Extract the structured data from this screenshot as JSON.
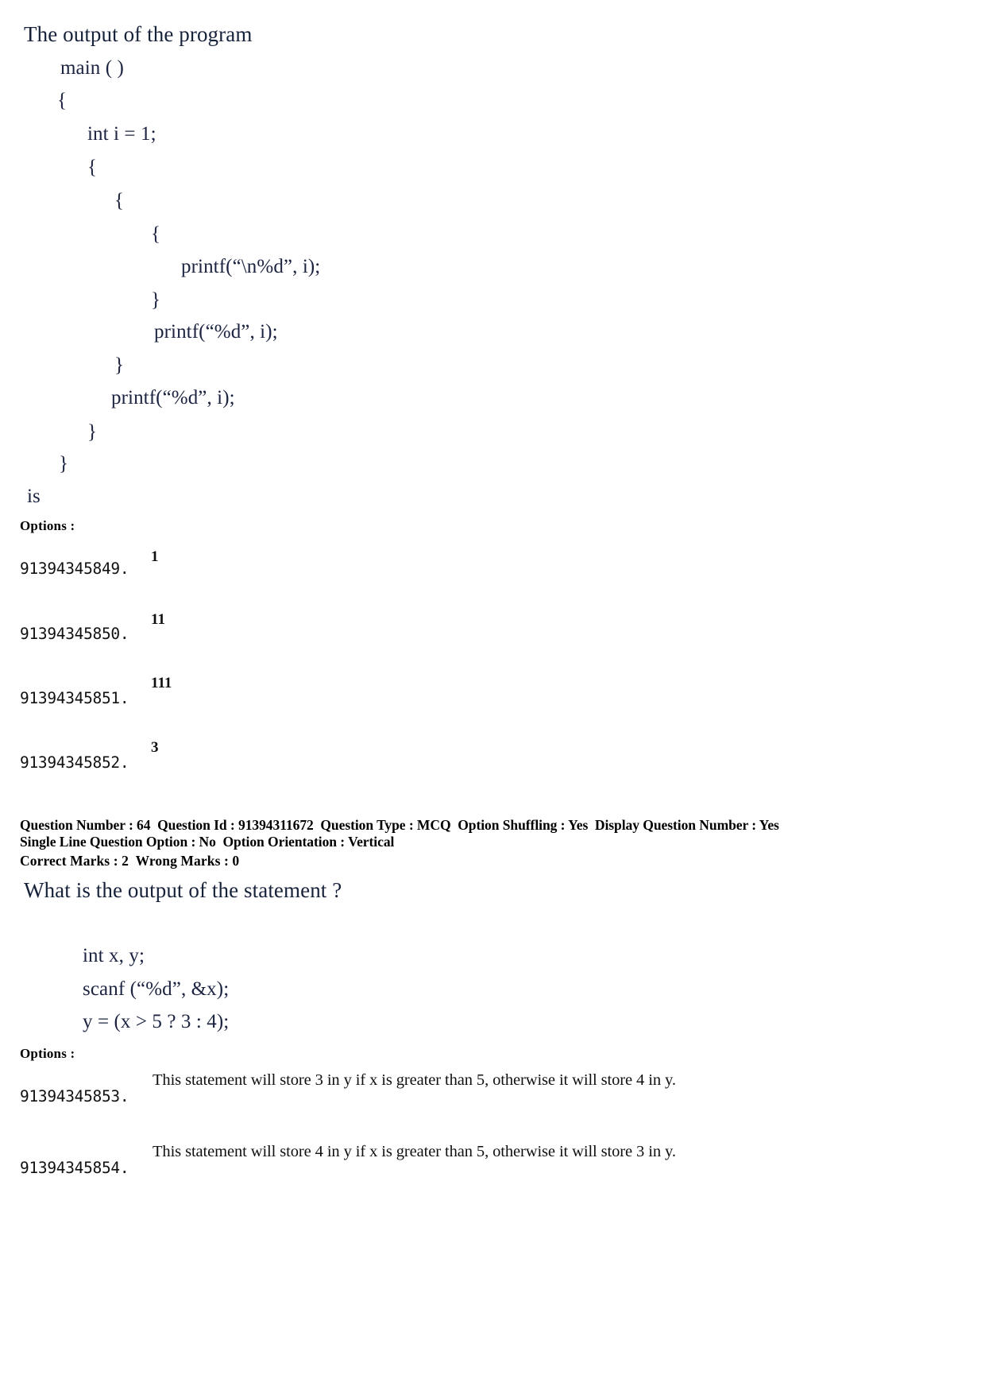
{
  "question_1": {
    "stem": "The output of the program",
    "code_lines": [
      {
        "text": "main ( )",
        "indent": 1
      },
      {
        "text": "{",
        "indent": 1
      },
      {
        "text": "int i = 1;",
        "indent": 2
      },
      {
        "text": "{",
        "indent": 2
      },
      {
        "text": "{",
        "indent": 3
      },
      {
        "text": "{",
        "indent": 4
      },
      {
        "text": "printf(“\\n%d”, i);",
        "indent": 5
      },
      {
        "text": "}",
        "indent": 4
      },
      {
        "text": "printf(“%d”, i);",
        "indent": 4
      },
      {
        "text": "}",
        "indent": 3
      },
      {
        "text": "printf(“%d”, i);",
        "indent": 3
      },
      {
        "text": "}",
        "indent": 2
      },
      {
        "text": "}",
        "indent": 1
      }
    ],
    "tail": "is",
    "options_label": "Options :",
    "options": [
      {
        "id": "91394345849.",
        "value": "1"
      },
      {
        "id": "91394345850.",
        "value": "11"
      },
      {
        "id": "91394345851.",
        "value": "111"
      },
      {
        "id": "91394345852.",
        "value": "3"
      }
    ]
  },
  "question_2": {
    "meta_line_1": "Question Number : 64  Question Id : 91394311672  Question Type : MCQ  Option Shuffling : Yes  Display Question Number : Yes",
    "meta_line_2": "Single Line Question Option : No  Option Orientation : Vertical",
    "marks_line": "Correct Marks : 2  Wrong Marks : 0",
    "stem": "What is the output of the statement ?",
    "code_lines": [
      {
        "text": "int x, y;"
      },
      {
        "text": "scanf (“%d”, &x);"
      },
      {
        "text": "y = (x > 5 ? 3 : 4);"
      }
    ],
    "options_label": "Options :",
    "options": [
      {
        "id": "91394345853.",
        "value": "This statement will store 3 in y if x is greater than 5, otherwise it will store 4 in y."
      },
      {
        "id": "91394345854.",
        "value": "This statement will store 4 in y if x is greater than 5, otherwise it will store 3 in y."
      }
    ]
  }
}
